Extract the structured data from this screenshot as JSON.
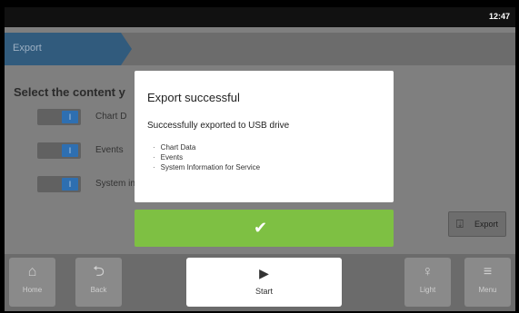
{
  "status_bar": {
    "time": "12:47"
  },
  "breadcrumb": {
    "label": "Export"
  },
  "page": {
    "heading": "Select the content y",
    "options": [
      {
        "label": "Chart D",
        "toggle_text": "I"
      },
      {
        "label": "Events",
        "toggle_text": "I"
      },
      {
        "label": "System information for service",
        "toggle_text": "I"
      }
    ],
    "export_button": {
      "label": "Export",
      "icon": "usb-export-icon"
    }
  },
  "dialog": {
    "title": "Export successful",
    "message": "Successfully exported to USB drive",
    "items": [
      "Chart Data",
      "Events",
      "System Information for Service"
    ],
    "ok_icon": "✔"
  },
  "nav": {
    "home": {
      "label": "Home",
      "icon": "⌂"
    },
    "back": {
      "label": "Back",
      "icon": "⮌"
    },
    "start": {
      "label": "Start",
      "icon": "▶"
    },
    "light": {
      "label": "Light",
      "icon": "♀"
    },
    "menu": {
      "label": "Menu",
      "icon": "≡"
    }
  }
}
